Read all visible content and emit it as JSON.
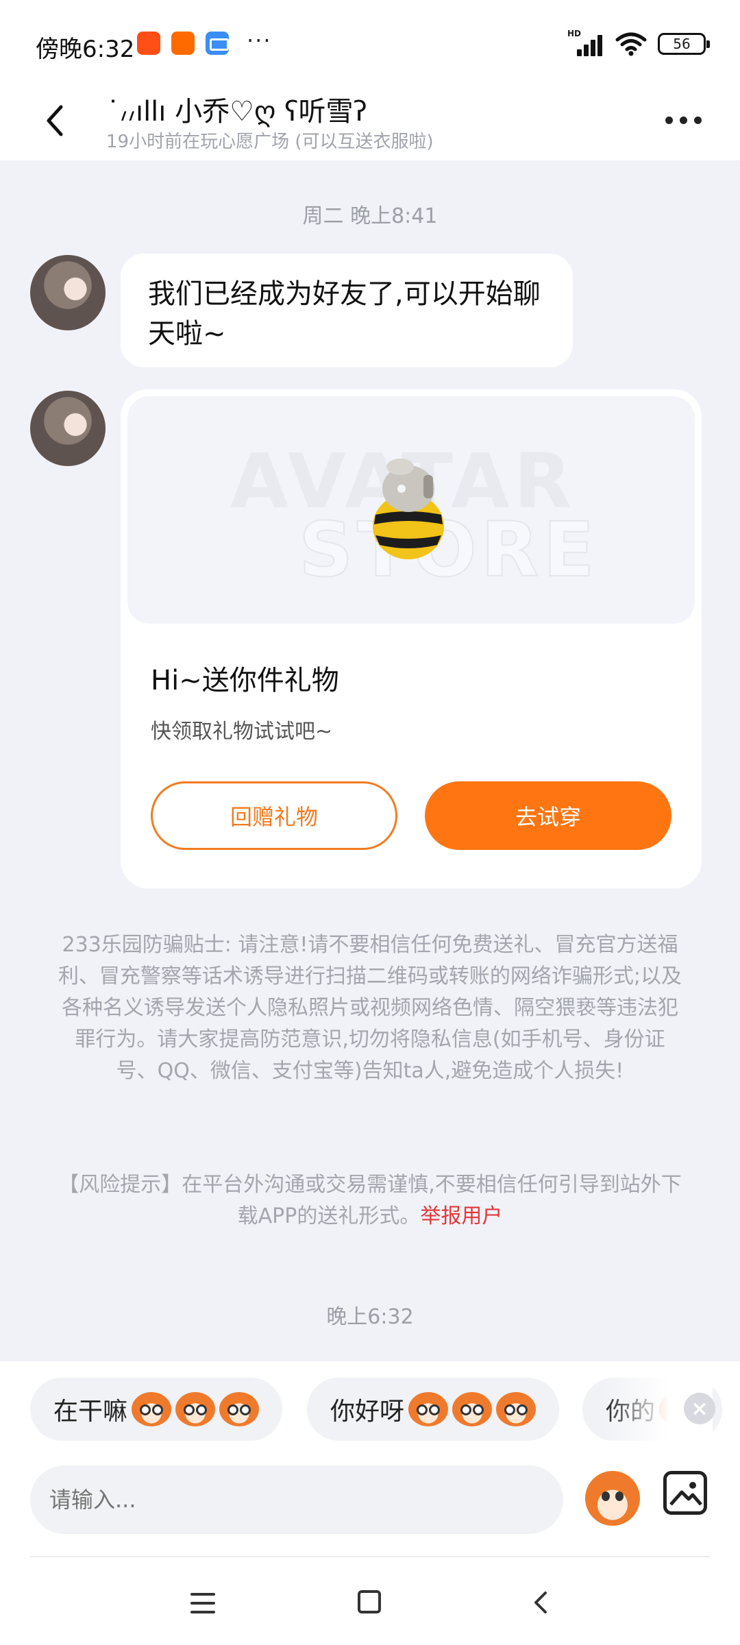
{
  "status_bar": {
    "time": "傍晚6:32",
    "dots": "···",
    "battery": "56",
    "hd_label": "HD"
  },
  "header": {
    "title": "˙៸៸ıllı 小乔♡ღ ʕ听雪ʔ",
    "subtitle": "19小时前在玩心愿广场 (可以互送衣服啦)"
  },
  "messages": {
    "date1": "周二 晚上8:41",
    "text1": "我们已经成为好友了,可以开始聊天啦~",
    "gift": {
      "watermark_line1": "AVATAR",
      "watermark_line2": "STORE",
      "title": "Hi~送你件礼物",
      "desc": "快领取礼物试试吧~",
      "return_label": "回赠礼物",
      "try_label": "去试穿"
    },
    "antifraud": "233乐园防骗贴士: 请注意!请不要相信任何免费送礼、冒充官方送福利、冒充警察等话术诱导进行扫描二维码或转账的网络诈骗形式;以及各种名义诱导发送个人隐私照片或视频网络色情、隔空猥亵等违法犯罪行为。请大家提高防范意识,切勿将隐私信息(如手机号、身份证号、QQ、微信、支付宝等)告知ta人,避免造成个人损失!",
    "risk_text": "【风险提示】在平台外沟通或交易需谨慎,不要相信任何引导到站外下载APP的送礼形式。",
    "report_link": "举报用户",
    "date2": "晚上6:32"
  },
  "quick_replies": [
    {
      "text": "在干嘛"
    },
    {
      "text": "你好呀"
    },
    {
      "text": "你的"
    }
  ],
  "input": {
    "placeholder": "请输入..."
  },
  "colors": {
    "accent": "#ff7511",
    "link": "#e2373a",
    "background": "#f1f2f7"
  }
}
